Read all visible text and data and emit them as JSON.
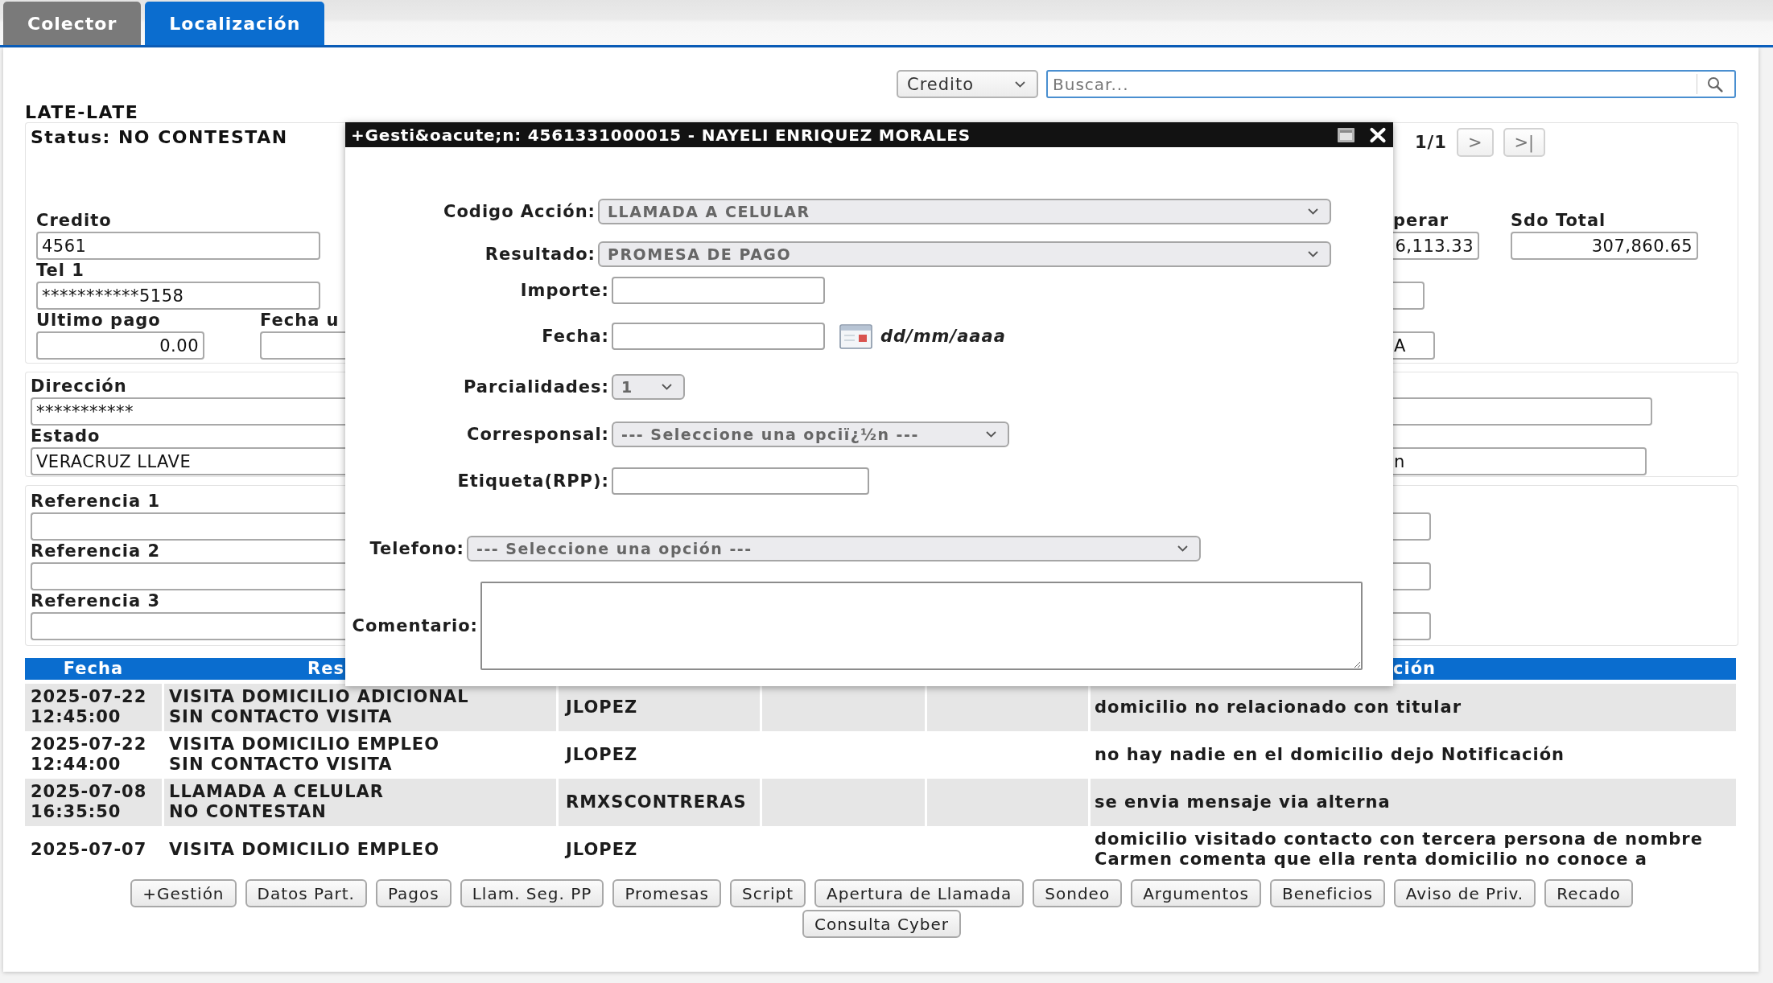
{
  "tabs": [
    {
      "label": "Colector",
      "selected": false
    },
    {
      "label": "Localización",
      "selected": true
    }
  ],
  "search": {
    "filter": "Credito",
    "placeholder": "Buscar..."
  },
  "list_title": "LATE-LATE",
  "panels": [
    {
      "status": "Status: NO CONTESTAN",
      "left_fields": [
        {
          "label": "Credito",
          "value": "4561",
          "kind": "text"
        },
        {
          "label": "Tel 1",
          "value": "***********5158",
          "kind": "text"
        },
        {
          "label": "Ultimo pago",
          "value": "0.00",
          "kind": "amount"
        },
        {
          "label": "Fecha u",
          "kind": "text"
        }
      ],
      "pager": {
        "position": "1/1",
        "next": ">",
        "last": ">|"
      },
      "right_fields": [
        {
          "label": "perar",
          "value": "6,113.33",
          "kind": "amount"
        },
        {
          "label": "Sdo Total",
          "value": "307,860.65",
          "kind": "amount"
        },
        {
          "kind": "text"
        },
        {
          "value": "A",
          "kind": "text"
        }
      ]
    },
    {
      "left_fields": [
        {
          "label": "Dirección",
          "value": "***********",
          "kind": "text"
        },
        {
          "label": "Estado",
          "value": "VERACRUZ LLAVE",
          "kind": "text"
        }
      ],
      "right_fields": [
        {
          "kind": "text"
        },
        {
          "value": "n",
          "kind": "text"
        }
      ]
    },
    {
      "left_fields": [
        {
          "label": "Referencia 1",
          "kind": "text"
        },
        {
          "label": "Referencia 2",
          "kind": "text"
        },
        {
          "label": "Referencia 3",
          "kind": "text"
        }
      ],
      "right_fields": [
        {
          "kind": "text"
        },
        {
          "kind": "text"
        },
        {
          "kind": "text"
        }
      ]
    }
  ],
  "history": {
    "columns": [
      "Fecha",
      "Res",
      "ción"
    ],
    "rows": [
      {
        "date": [
          "2025-07-22",
          "12:45:00"
        ],
        "column_2": [
          "VISITA DOMICILIO ADICIONAL",
          "SIN CONTACTO VISITA"
        ],
        "column_3": "JLOPEZ",
        "column_6": [
          "domicilio no relacionado con titular"
        ]
      },
      {
        "date": [
          "2025-07-22",
          "12:44:00"
        ],
        "column_2": [
          "VISITA DOMICILIO EMPLEO",
          "SIN CONTACTO VISITA"
        ],
        "column_3": "JLOPEZ",
        "column_6": [
          "no hay nadie en el domicilio dejo Notificación"
        ]
      },
      {
        "date": [
          "2025-07-08",
          "16:35:50"
        ],
        "column_2": [
          "LLAMADA A CELULAR",
          "NO CONTESTAN"
        ],
        "column_3": "RMXSCONTRERAS",
        "column_6": [
          "se envia mensaje via alterna"
        ]
      },
      {
        "date": [
          "2025-07-07"
        ],
        "column_2": [
          "VISITA DOMICILIO EMPLEO"
        ],
        "column_3": "JLOPEZ",
        "column_6": [
          "domicilio visitado contacto con tercera persona de nombre",
          "Carmen comenta que ella renta domicilio no conoce a"
        ]
      }
    ]
  },
  "actions": [
    "+Gestión",
    "Datos Part.",
    "Pagos",
    "Llam. Seg. PP",
    "Promesas",
    "Script",
    "Apertura de Llamada",
    "Sondeo",
    "Argumentos",
    "Beneficios",
    "Aviso de Priv.",
    "Recado",
    "Consulta Cyber"
  ],
  "dialog": {
    "title": "+Gesti&oacute;n: 4561331000015 - NAYELI ENRIQUEZ MORALES",
    "fields": [
      {
        "label": "Codigo Acción:",
        "kind": "select",
        "value": "LLAMADA A CELULAR"
      },
      {
        "label": "Resultado:",
        "kind": "select",
        "value": "PROMESA DE PAGO"
      },
      {
        "label": "Importe:",
        "kind": "input"
      },
      {
        "label": "Fecha:",
        "kind": "date",
        "format": "dd/mm/aaaa"
      },
      {
        "label": "Parcialidades:",
        "kind": "select",
        "value": "1"
      },
      {
        "label": "Corresponsal:",
        "kind": "select",
        "value": "--- Seleccione una opciï¿½n ---"
      },
      {
        "label": "Etiqueta(RPP):",
        "kind": "input"
      },
      {
        "label": "Telefono:",
        "kind": "select",
        "value": "--- Seleccione una opción ---"
      },
      {
        "label": "Comentario:",
        "kind": "textarea"
      }
    ]
  }
}
